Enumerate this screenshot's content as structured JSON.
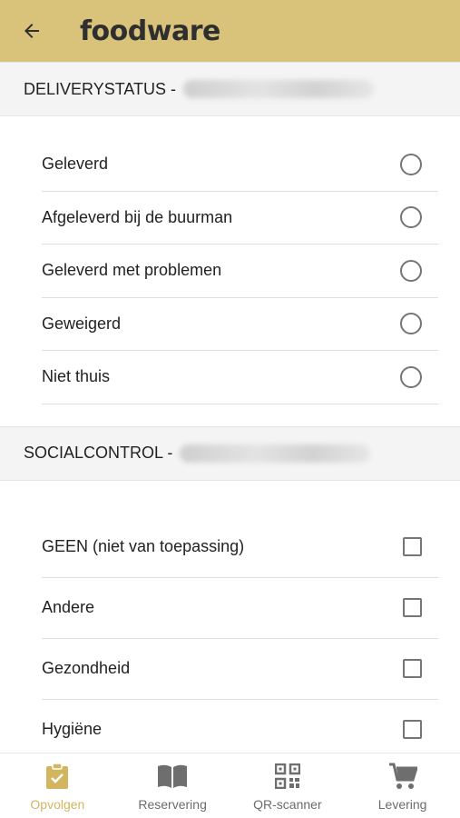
{
  "header": {
    "back_icon": "arrow-left-icon",
    "logo_text": "foodware"
  },
  "delivery_section": {
    "title": "DELIVERYSTATUS -",
    "options": [
      {
        "label": "Geleverd",
        "selected": false
      },
      {
        "label": "Afgeleverd bij de buurman",
        "selected": false
      },
      {
        "label": "Geleverd met problemen",
        "selected": false
      },
      {
        "label": "Geweigerd",
        "selected": false
      },
      {
        "label": "Niet thuis",
        "selected": false
      }
    ]
  },
  "social_section": {
    "title": "SOCIALCONTROL -",
    "options": [
      {
        "label": "GEEN (niet van toepassing)",
        "checked": false
      },
      {
        "label": "Andere",
        "checked": false
      },
      {
        "label": "Gezondheid",
        "checked": false
      },
      {
        "label": "Hygiëne",
        "checked": false
      }
    ]
  },
  "bottom_nav": {
    "items": [
      {
        "label": "Opvolgen",
        "icon": "clipboard-check-icon",
        "active": true
      },
      {
        "label": "Reservering",
        "icon": "book-icon",
        "active": false
      },
      {
        "label": "QR-scanner",
        "icon": "qr-code-icon",
        "active": false
      },
      {
        "label": "Levering",
        "icon": "cart-icon",
        "active": false
      }
    ]
  },
  "colors": {
    "header_bg": "#d9c37a",
    "accent": "#d3b560",
    "icon_inactive": "#6e6e6e",
    "section_bg": "#f4f4f4"
  }
}
